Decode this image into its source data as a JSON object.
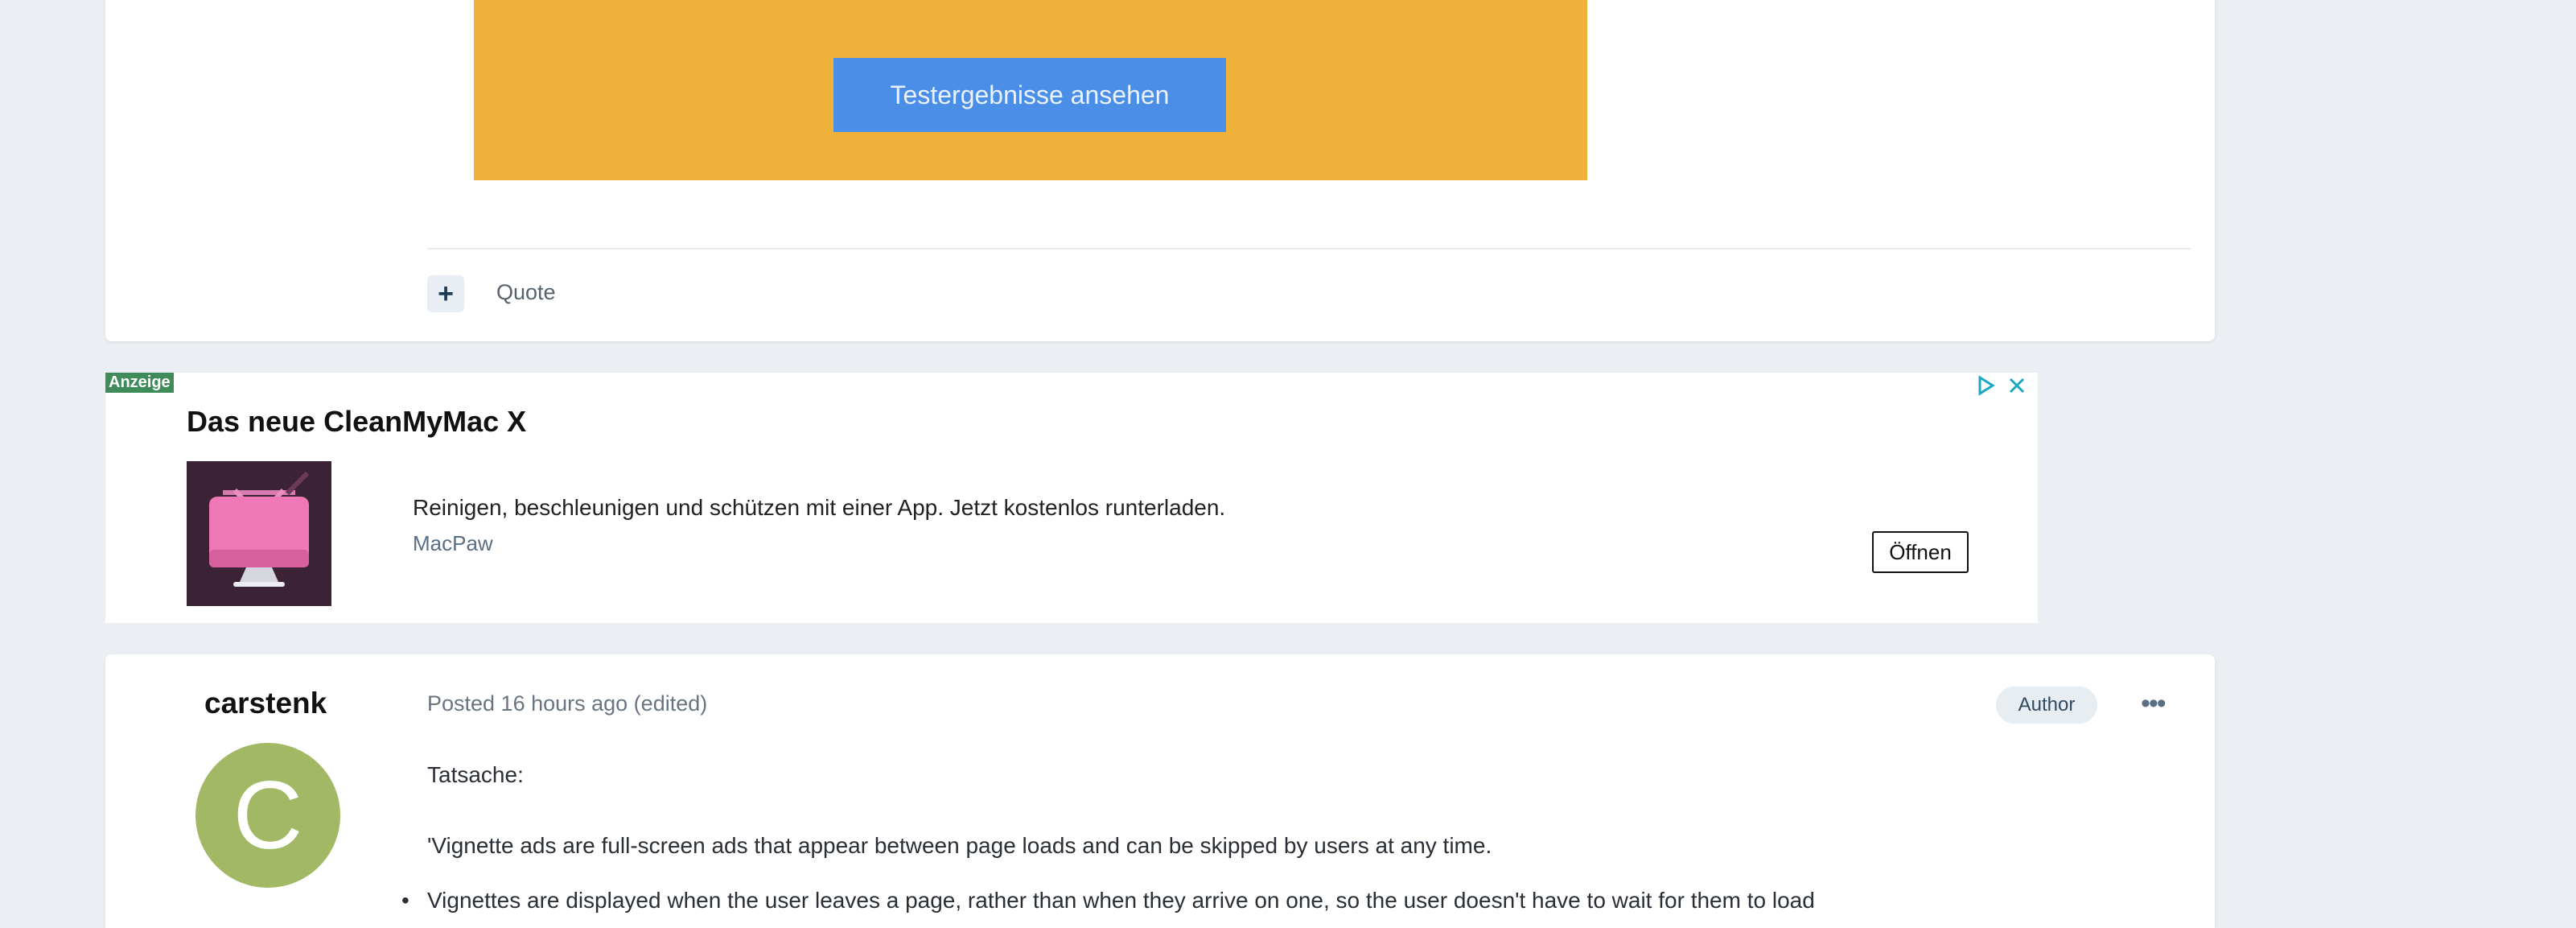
{
  "top_card": {
    "cta_label": "Testergebnisse ansehen",
    "quote_label": "Quote",
    "plus_icon": "plus-icon"
  },
  "ad": {
    "label": "Anzeige",
    "title": "Das neue CleanMyMac X",
    "description": "Reinigen, beschleunigen und schützen mit einer App. Jetzt kostenlos runterladen.",
    "brand": "MacPaw",
    "open_label": "Öffnen",
    "icons": [
      "adchoices-icon",
      "close-icon"
    ]
  },
  "post": {
    "username": "carstenk",
    "avatar_letter": "C",
    "posted": "Posted 16 hours ago (edited)",
    "badge": "Author",
    "more_icon": "more-horizontal-icon",
    "paragraph1": "Tatsache:",
    "paragraph2": "'Vignette ads are full-screen ads that appear between page loads and can be skipped by users at any time.",
    "list": [
      "Vignettes are displayed when the user leaves a page, rather than when they arrive on one, so the user doesn't have to wait for them to load"
    ]
  },
  "colors": {
    "orange_banner": "#f0b13b",
    "cta_blue": "#4a8ee8",
    "ad_label_green": "#3f8c5a",
    "avatar_green": "#a2b864"
  }
}
